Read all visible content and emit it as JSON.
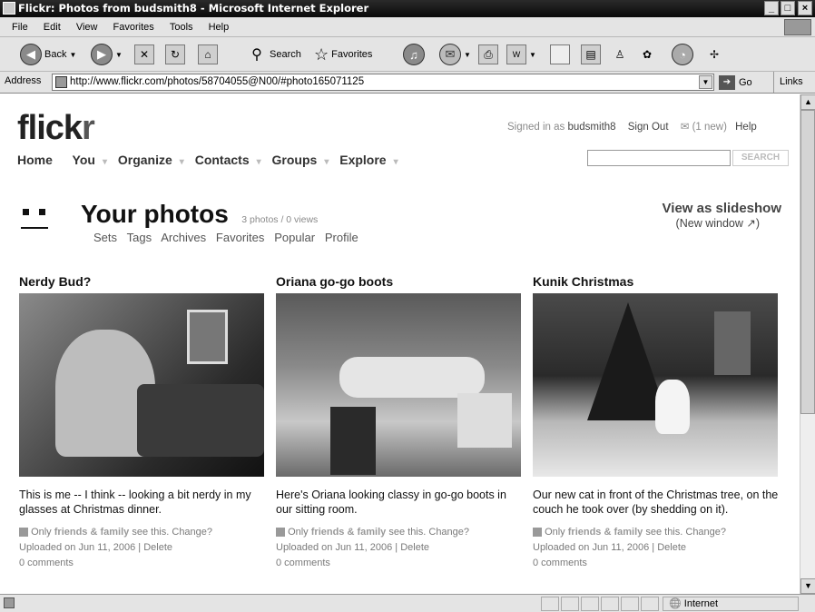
{
  "window": {
    "title": "Flickr: Photos from budsmith8 - Microsoft Internet Explorer",
    "controls": [
      "_",
      "□",
      "×"
    ]
  },
  "menu": [
    "File",
    "Edit",
    "View",
    "Favorites",
    "Tools",
    "Help"
  ],
  "toolbar": {
    "back_label": "Back",
    "search_label": "Search",
    "favorites_label": "Favorites",
    "icons": [
      "back-icon",
      "forward-icon",
      "stop-icon",
      "refresh-icon",
      "home-icon",
      "search-icon",
      "favorites-icon",
      "media-icon",
      "mail-icon",
      "print-icon",
      "edit-icon",
      "discuss-icon",
      "research-icon",
      "messenger-icon"
    ]
  },
  "address": {
    "label": "Address",
    "url": "http://www.flickr.com/photos/58704055@N00/#photo165071125",
    "go_label": "Go",
    "links_label": "Links"
  },
  "flickr": {
    "logo_main": "flick",
    "logo_r": "r",
    "signed_in_as": "Signed in as",
    "username": "budsmith8",
    "sign_out": "Sign Out",
    "mail": "(1 new)",
    "help": "Help",
    "search_button": "SEARCH",
    "search_value": "",
    "nav": [
      "Home",
      "You",
      "Organize",
      "Contacts",
      "Groups",
      "Explore"
    ]
  },
  "heading": {
    "title": "Your photos",
    "stats": "3 photos / 0 views",
    "subnav": [
      "Sets",
      "Tags",
      "Archives",
      "Favorites",
      "Popular",
      "Profile"
    ],
    "slideshow": "View as slideshow",
    "slideshow_sub": "(New window ↗)"
  },
  "photos": [
    {
      "title": "Nerdy Bud?",
      "caption": "This is me -- I think -- looking a bit nerdy in my glasses at Christmas dinner.",
      "privacy_prefix": "Only",
      "privacy_group": "friends & family",
      "privacy_suffix": "see this.",
      "change": "Change?",
      "uploaded": "Uploaded on Jun 11, 2006",
      "delete": "Delete",
      "comments": "0 comments"
    },
    {
      "title": "Oriana go-go boots",
      "caption": "Here's Oriana looking classy in go-go boots in our sitting room.",
      "privacy_prefix": "Only",
      "privacy_group": "friends & family",
      "privacy_suffix": "see this.",
      "change": "Change?",
      "uploaded": "Uploaded on Jun 11, 2006",
      "delete": "Delete",
      "comments": "0 comments"
    },
    {
      "title": "Kunik Christmas",
      "caption": "Our new cat in front of the Christmas tree, on the couch he took over (by shedding on it).",
      "privacy_prefix": "Only",
      "privacy_group": "friends & family",
      "privacy_suffix": "see this.",
      "change": "Change?",
      "uploaded": "Uploaded on Jun 11, 2006",
      "delete": "Delete",
      "comments": "0 comments"
    }
  ],
  "status": {
    "zone": "Internet"
  }
}
